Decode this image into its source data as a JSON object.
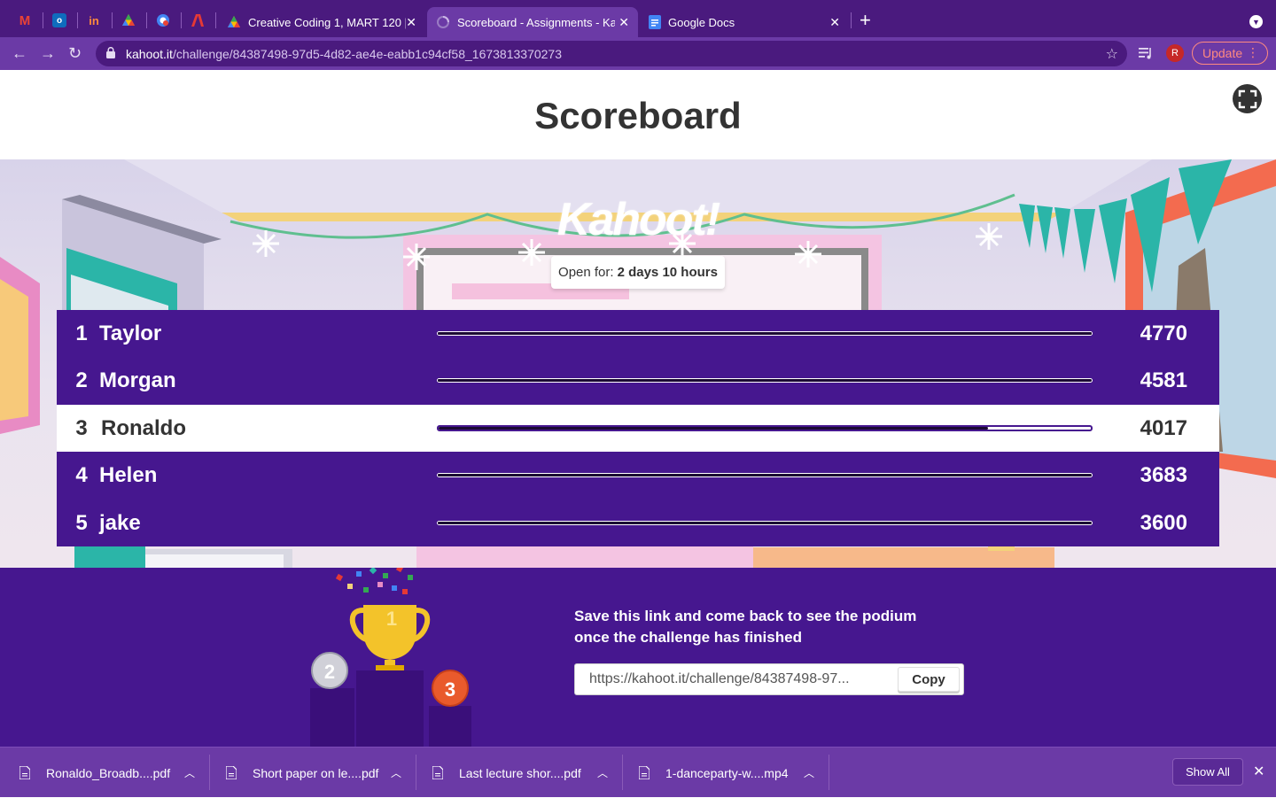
{
  "browser": {
    "pinned_tabs": [
      {
        "icon": "gmail-icon",
        "color": "#ea4335",
        "glyph": "M"
      },
      {
        "icon": "outlook-icon",
        "color": "#0f6cbd",
        "glyph": "o"
      },
      {
        "icon": "invision-icon",
        "color": "#ff3366",
        "glyph": "in"
      },
      {
        "icon": "drive-icon",
        "color": "#fbbc04",
        "glyph": "▲"
      },
      {
        "icon": "chrome-web-icon",
        "color": "#4285f4",
        "glyph": "G"
      },
      {
        "icon": "adobe-icon",
        "color": "#e53935",
        "glyph": "A"
      }
    ],
    "tabs": [
      {
        "label": "Creative Coding 1, MART 120 |",
        "close": "✕"
      },
      {
        "label": "Scoreboard - Assignments - Ka",
        "close": "✕"
      },
      {
        "label": "Google Docs",
        "close": "✕"
      }
    ],
    "new_tab": "+",
    "url_domain": "kahoot.it",
    "url_path": "/challenge/84387498-97d5-4d82-ae4e-eabb1c94cf58_1673813370273",
    "avatar_letter": "R",
    "update_label": "Update"
  },
  "page": {
    "title": "Scoreboard",
    "logo": "Kahoot!",
    "open_for_label": "Open for:",
    "open_for_value": "2 days 10 hours",
    "max_score": 4770,
    "players": [
      {
        "rank": "1",
        "name": "Taylor",
        "score": "4770",
        "score_value": 4770,
        "highlight": false
      },
      {
        "rank": "2",
        "name": "Morgan",
        "score": "4581",
        "score_value": 4581,
        "highlight": false
      },
      {
        "rank": "3",
        "name": "Ronaldo",
        "score": "4017",
        "score_value": 4017,
        "highlight": true
      },
      {
        "rank": "4",
        "name": "Helen",
        "score": "3683",
        "score_value": 3683,
        "highlight": false
      },
      {
        "rank": "5",
        "name": "jake",
        "score": "3600",
        "score_value": 3600,
        "highlight": false
      }
    ],
    "podium": {
      "first": "1",
      "second": "2",
      "third": "3"
    },
    "save_text_line1": "Save this link and come back to see the podium",
    "save_text_line2": "once the challenge has finished",
    "share_link": "https://kahoot.it/challenge/84387498-97...",
    "copy_label": "Copy"
  },
  "downloads": {
    "items": [
      {
        "name": "Ronaldo_Broadb....pdf"
      },
      {
        "name": "Short paper on le....pdf"
      },
      {
        "name": "Last lecture shor....pdf"
      },
      {
        "name": "1-danceparty-w....mp4"
      }
    ],
    "show_all_label": "Show All"
  },
  "colors": {
    "kahoot_purple": "#46178f",
    "browser_dark": "#4a1a7e",
    "browser_light": "#6b3aa6",
    "update_accent": "#ff8a80"
  }
}
